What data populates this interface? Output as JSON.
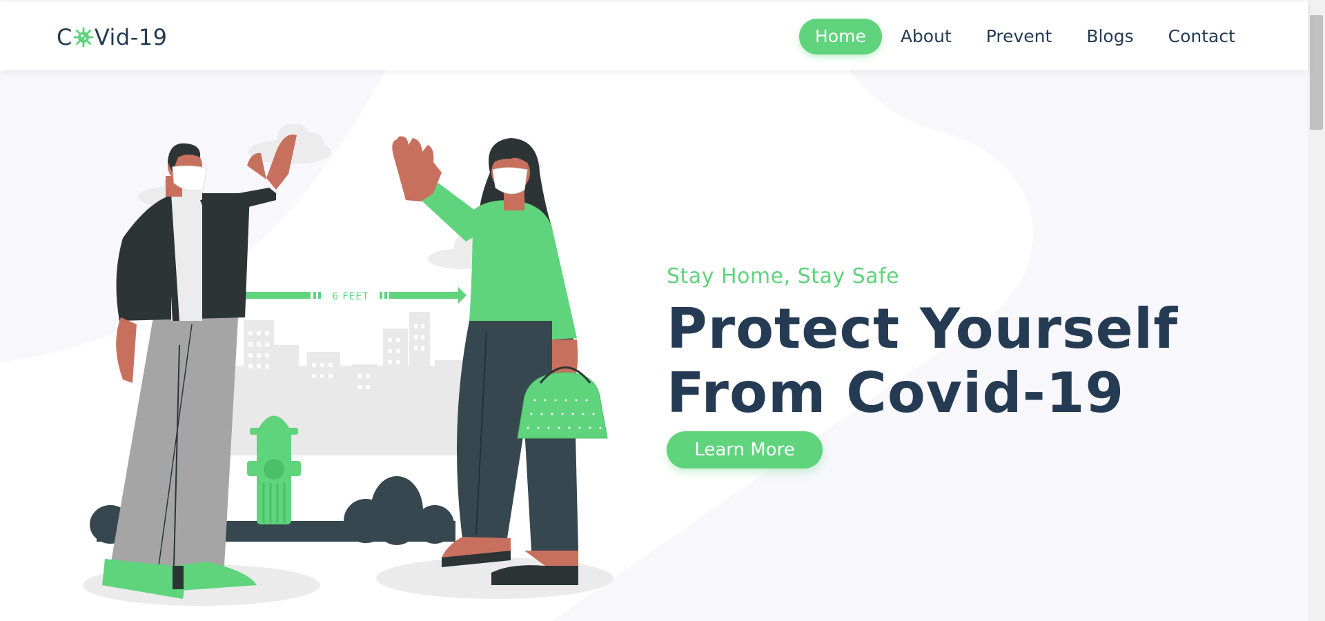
{
  "logo": {
    "text_before": "C",
    "icon": "virus-icon",
    "text_after": "Vid-19"
  },
  "nav": {
    "items": [
      {
        "label": "Home",
        "active": true
      },
      {
        "label": "About",
        "active": false
      },
      {
        "label": "Prevent",
        "active": false
      },
      {
        "label": "Blogs",
        "active": false
      },
      {
        "label": "Contact",
        "active": false
      }
    ]
  },
  "hero": {
    "subtitle": "Stay Home, Stay Safe",
    "headline_line1": "Protect Yourself",
    "headline_line2": "From Covid-19",
    "cta_label": "Learn More",
    "distance_label": "6 FEET"
  },
  "colors": {
    "accent": "#5fd47c",
    "heading": "#243b53",
    "background_tint": "#f7f7fc"
  }
}
